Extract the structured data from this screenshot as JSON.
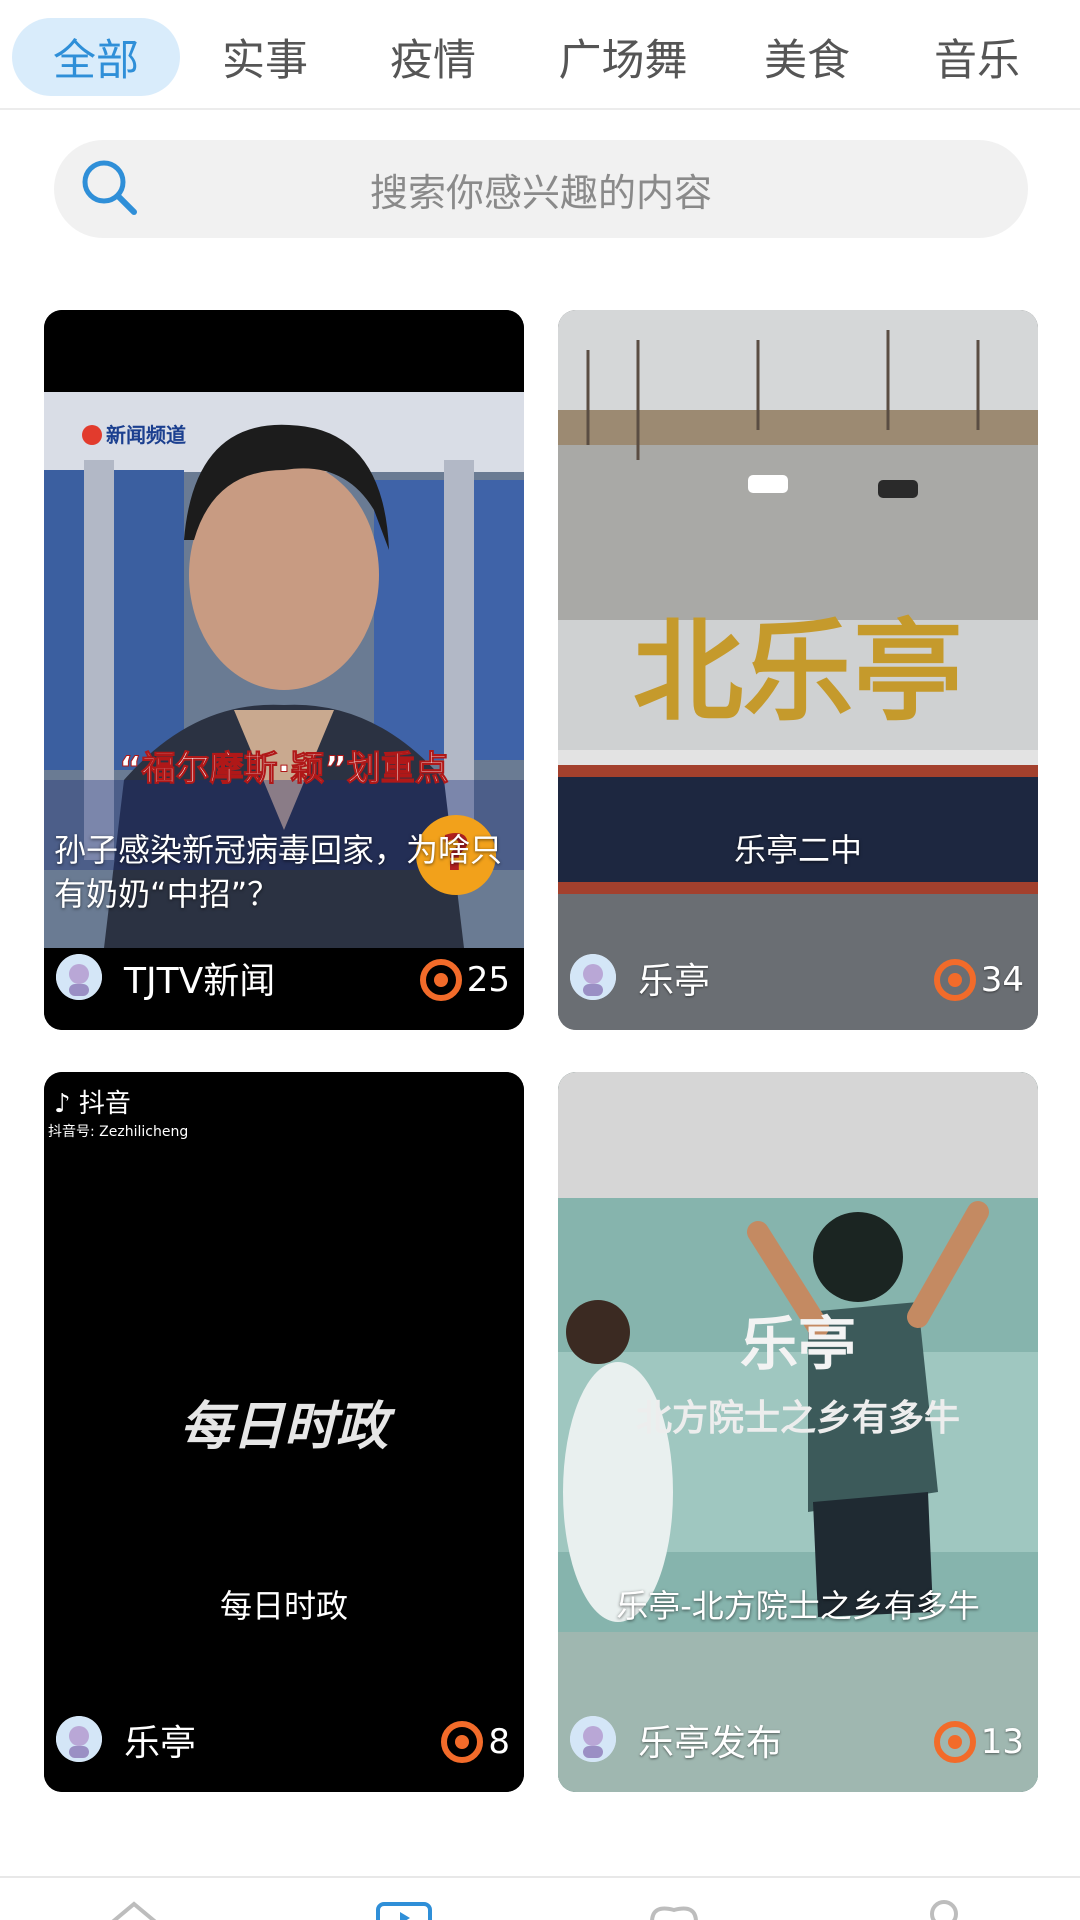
{
  "tabs": [
    {
      "label": "全部"
    },
    {
      "label": "实事"
    },
    {
      "label": "疫情"
    },
    {
      "label": "广场舞"
    },
    {
      "label": "美食"
    },
    {
      "label": "音乐"
    }
  ],
  "search": {
    "placeholder": "搜索你感兴趣的内容"
  },
  "cards": [
    {
      "title": "孙子感染新冠病毒回家，为啥只有奶奶“中招”？",
      "author": "TJTV新闻",
      "views": "25",
      "thumb_overlay": [
        "新闻频道",
        "“福尔摩斯·颖”划重点"
      ]
    },
    {
      "title": "乐亭二中",
      "author": "乐亭",
      "views": "34"
    },
    {
      "title": "每日时政",
      "author": "乐亭",
      "views": "8",
      "thumb_overlay": [
        "抖音",
        "抖音号: Zezhilicheng",
        "每日时政"
      ]
    },
    {
      "title": "乐亭-北方院士之乡有多牛",
      "author": "乐亭发布",
      "views": "13",
      "thumb_overlay": [
        "乐亭",
        "北方院士之乡有多牛"
      ]
    }
  ],
  "colors": {
    "accent": "#2f8fd8",
    "tab_active_bg": "#d9ecfb",
    "view_icon": "#f26b2a"
  },
  "bottom_nav": {
    "icons": [
      "home-icon",
      "video-icon",
      "heart-icon",
      "profile-icon"
    ]
  }
}
